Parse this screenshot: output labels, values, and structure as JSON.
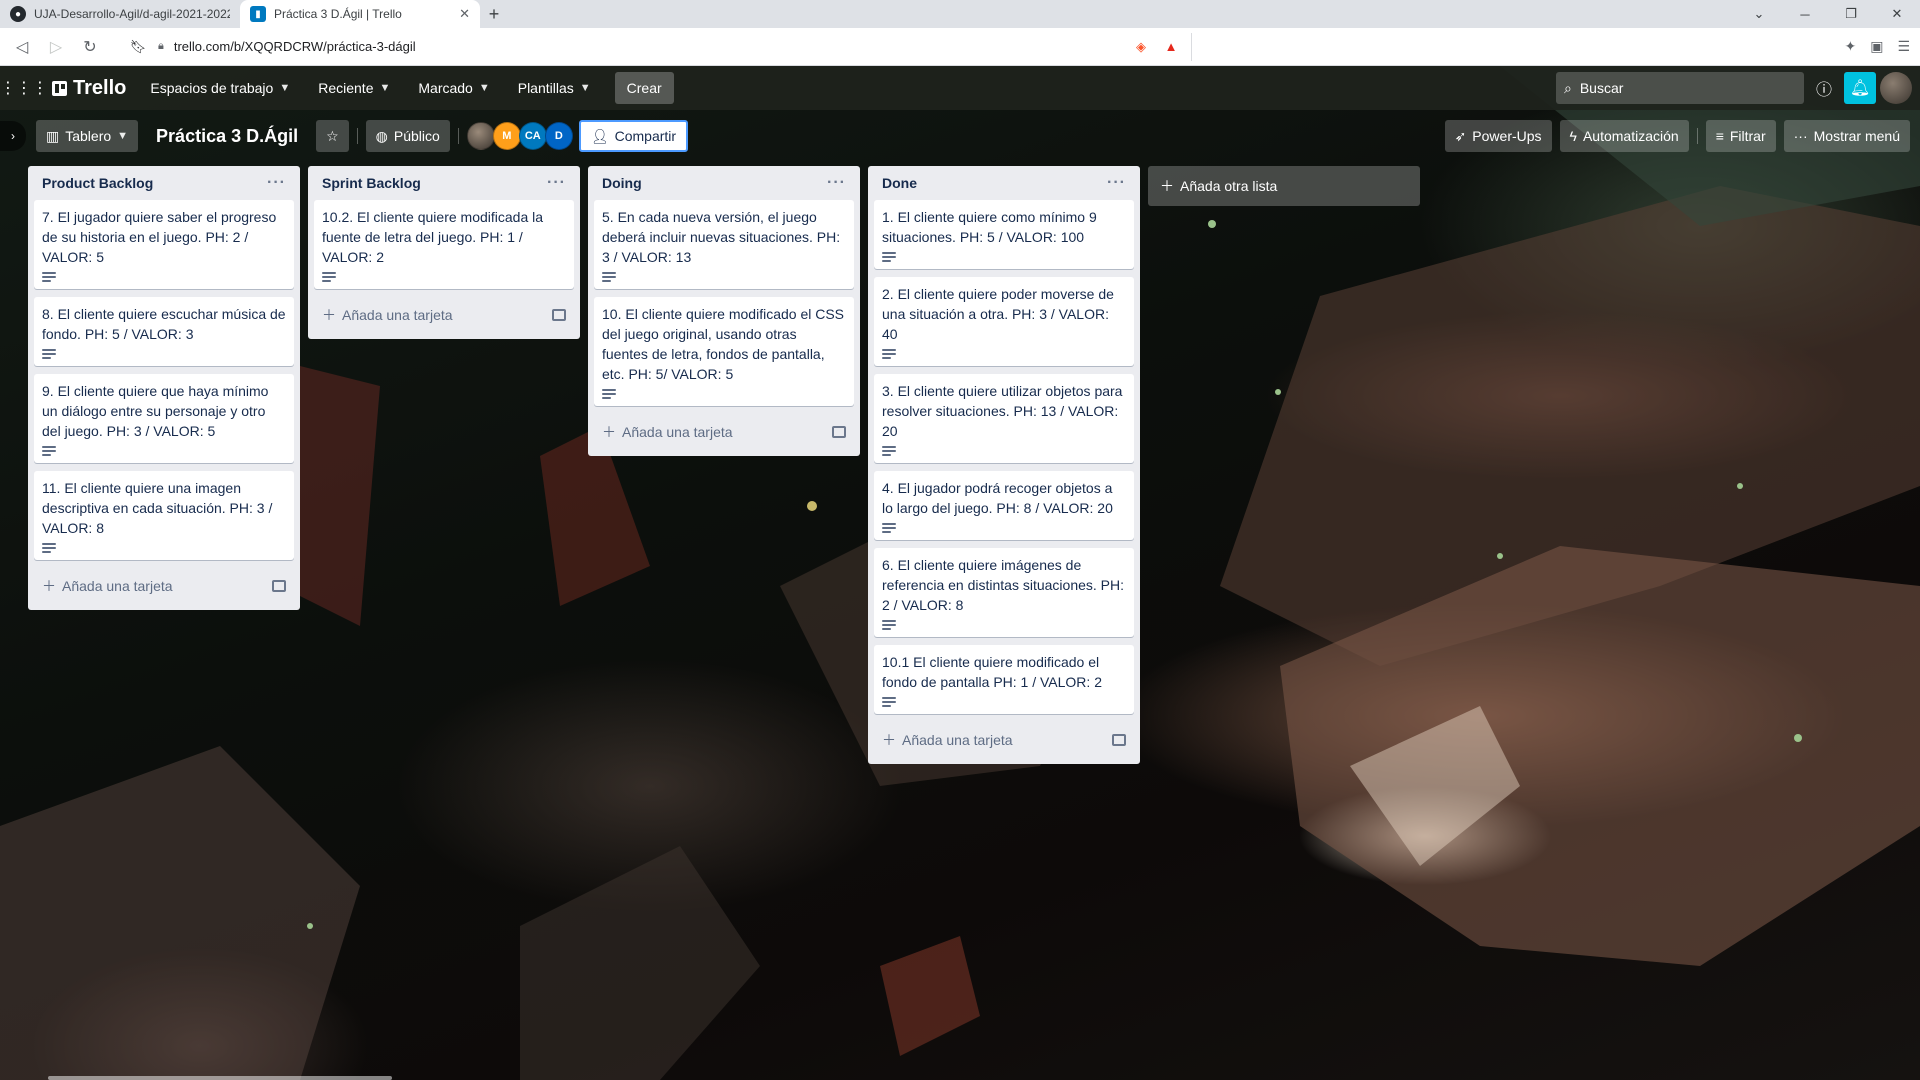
{
  "browser": {
    "tabs": [
      {
        "title": "UJA-Desarrollo-Agil/d-agil-2021-2022",
        "active": false
      },
      {
        "title": "Práctica 3 D.Ágil | Trello",
        "active": true
      }
    ],
    "url": "trello.com/b/XQQRDCRW/práctica-3-dágil",
    "brave_badge": "2"
  },
  "header": {
    "logo": "Trello",
    "menus": [
      "Espacios de trabajo",
      "Reciente",
      "Marcado",
      "Plantillas"
    ],
    "create": "Crear",
    "search_placeholder": "Buscar"
  },
  "board": {
    "view": "Tablero",
    "title": "Práctica 3 D.Ágil",
    "visibility": "Público",
    "members": [
      "",
      "M",
      "CA",
      "D"
    ],
    "share": "Compartir",
    "powerups": "Power-Ups",
    "automation": "Automatización",
    "filter": "Filtrar",
    "menu": "Mostrar menú",
    "add_list": "Añada otra lista"
  },
  "lists": [
    {
      "title": "Product Backlog",
      "add_card": "Añada una tarjeta",
      "cards": [
        "7. El jugador quiere saber el progreso de su historia en el juego. PH: 2 / VALOR: 5",
        "8. El cliente quiere escuchar música de fondo. PH: 5 / VALOR: 3",
        "9. El cliente quiere que haya mínimo un diálogo entre su personaje y otro del juego. PH: 3 / VALOR: 5",
        "11. El cliente quiere una imagen descriptiva en cada situación. PH: 3 / VALOR: 8"
      ]
    },
    {
      "title": "Sprint Backlog",
      "add_card": "Añada una tarjeta",
      "cards": [
        "10.2. El cliente quiere modificada la fuente de letra del juego. PH: 1 / VALOR: 2"
      ]
    },
    {
      "title": "Doing",
      "add_card": "Añada una tarjeta",
      "cards": [
        "5. En cada nueva versión, el juego deberá incluir nuevas situaciones. PH: 3 / VALOR: 13",
        "10. El cliente quiere modificado el CSS del juego original, usando otras fuentes de letra, fondos de pantalla, etc. PH: 5/ VALOR: 5"
      ]
    },
    {
      "title": "Done",
      "add_card": "Añada una tarjeta",
      "cards": [
        "1. El cliente quiere como mínimo 9 situaciones. PH: 5 / VALOR: 100",
        "2. El cliente quiere poder moverse de una situación a otra. PH: 3 / VALOR: 40",
        "3. El cliente quiere utilizar objetos para resolver situaciones. PH: 13 / VALOR: 20",
        "4. El jugador podrá recoger objetos a lo largo del juego. PH: 8 / VALOR: 20",
        "6. El cliente quiere imágenes de referencia en distintas situaciones. PH: 2 / VALOR: 8",
        "10.1 El cliente quiere modificado el fondo de pantalla PH: 1 / VALOR: 2"
      ]
    }
  ],
  "colors": {
    "accent": "#00c2e0",
    "list_bg": "#ebecf0",
    "header_bg": "#1e231c"
  }
}
